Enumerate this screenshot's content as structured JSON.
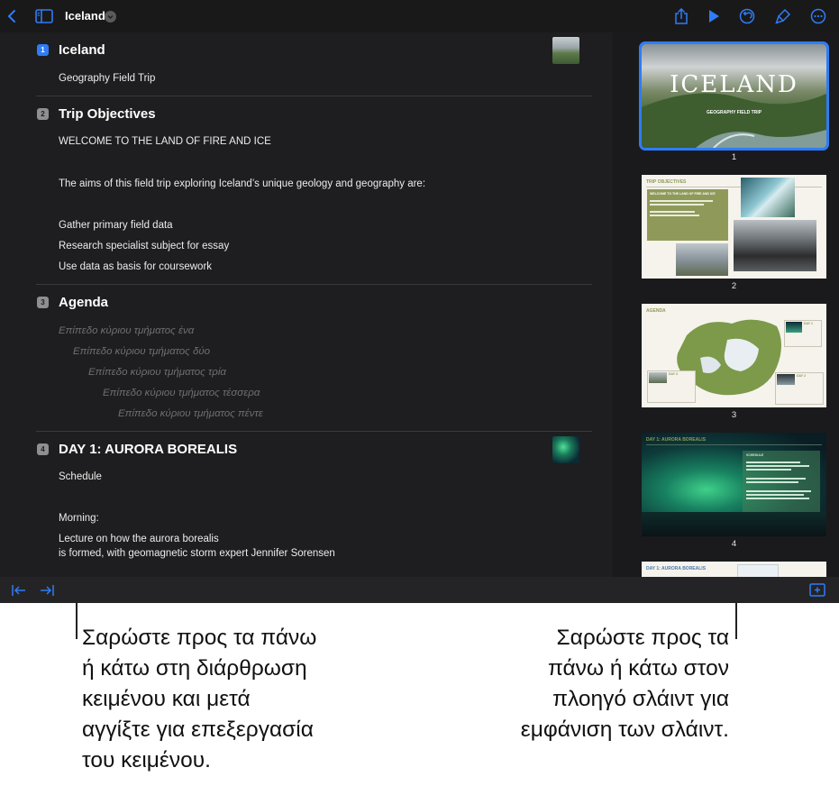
{
  "toolbar": {
    "back_icon": "chevron-left-icon",
    "sidebar_icon": "sidebar-icon",
    "title": "Iceland",
    "share_icon": "share-icon",
    "play_icon": "play-icon",
    "undo_icon": "undo-icon",
    "format_icon": "paintbrush-icon",
    "more_icon": "ellipsis-icon"
  },
  "outline": {
    "slides": [
      {
        "num": "1",
        "title": "Iceland",
        "lines": [
          "Geography Field Trip"
        ]
      },
      {
        "num": "2",
        "title": "Trip Objectives",
        "lines": [
          "WELCOME TO THE LAND OF FIRE AND ICE",
          "The aims of this field trip exploring Iceland’s unique geology and geography are:",
          "Gather primary field data",
          "Research specialist subject for essay",
          "Use data as basis for coursework"
        ]
      },
      {
        "num": "3",
        "title": "Agenda",
        "placeholders": [
          "Επίπεδο κύριου τμήματος ένα",
          "Επίπεδο κύριου τμήματος δύο",
          "Επίπεδο κύριου τμήματος τρία",
          "Επίπεδο κύριου τμήματος τέσσερα",
          "Επίπεδο κύριου τμήματος πέντε"
        ]
      },
      {
        "num": "4",
        "title": "DAY 1: AURORA BOREALIS",
        "lines": [
          "Schedule",
          "Morning:",
          "Lecture on how the aurora borealis",
          "is formed, with geomagnetic storm expert Jennifer Sorensen"
        ]
      }
    ]
  },
  "navigator": {
    "thumbs": [
      {
        "num": "1",
        "big_title": "ICELAND",
        "subtitle": "GEOGRAPHY FIELD TRIP"
      },
      {
        "num": "2",
        "header": "TRIP OBJECTIVES",
        "box_title": "WELCOME TO THE LAND OF FIRE AND ICE"
      },
      {
        "num": "3",
        "header": "AGENDA",
        "day_a": "DAY 1",
        "day_b": "DAY 2",
        "day_c": "DAY 3"
      },
      {
        "num": "4",
        "header": "DAY 1: AURORA BOREALIS",
        "box_title": "SCHEDULE"
      },
      {
        "header": "DAY 1: AURORA BOREALIS"
      }
    ]
  },
  "bottombar": {
    "outdent_icon": "outdent-icon",
    "indent_icon": "indent-icon",
    "add_slide_icon": "add-slide-icon"
  },
  "callouts": {
    "left": [
      "Σαρώστε προς τα πάνω",
      "ή κάτω στη διάρθρωση",
      "κειμένου και μετά",
      "αγγίξτε για επεξεργασία",
      "του κειμένου."
    ],
    "right": [
      "Σαρώστε προς τα",
      "πάνω ή κάτω στον",
      "πλοηγό σλάιντ για",
      "εμφάνιση των σλάιντ."
    ]
  },
  "colors": {
    "accent": "#2f7cf6",
    "app_bg": "#1e1e20",
    "thumb_olive": "#8f9a5a"
  }
}
